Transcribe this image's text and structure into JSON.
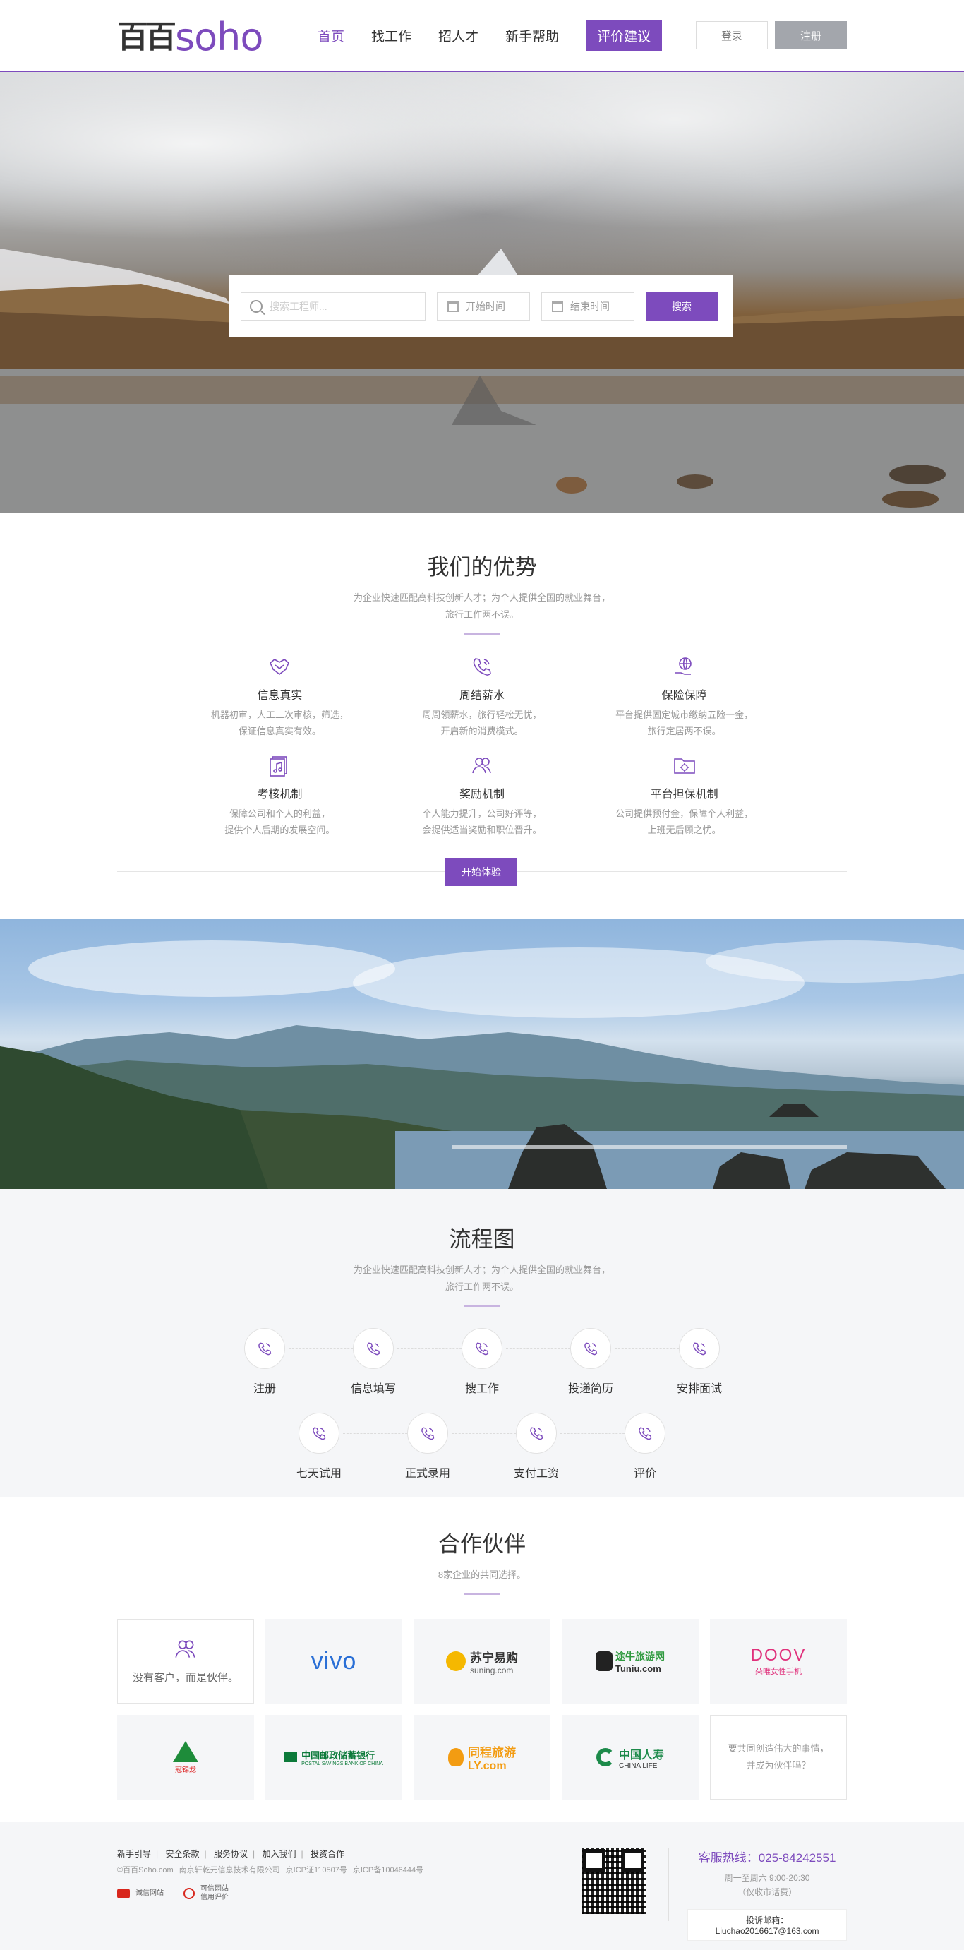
{
  "header": {
    "logo_cn": "百百",
    "logo_en": "soho",
    "nav": [
      "首页",
      "找工作",
      "招人才",
      "新手帮助"
    ],
    "suggest": "评价建议",
    "login": "登录",
    "register": "注册"
  },
  "search": {
    "placeholder": "搜索工程师...",
    "start": "开始时间",
    "end": "结束时间",
    "button": "搜索"
  },
  "advantages": {
    "title": "我们的优势",
    "sub1": "为企业快速匹配高科技创新人才；为个人提供全国的就业舞台，",
    "sub2": "旅行工作两不误。",
    "items": [
      {
        "icon": "handshake-icon",
        "title": "信息真实",
        "l1": "机器初审，人工二次审核，筛选，",
        "l2": "保证信息真实有效。"
      },
      {
        "icon": "phone-icon",
        "title": "周结薪水",
        "l1": "周周领薪水，旅行轻松无忧，",
        "l2": "开启新的消费模式。"
      },
      {
        "icon": "globe-hand-icon",
        "title": "保险保障",
        "l1": "平台提供固定城市缴纳五险一金，",
        "l2": "旅行定居两不误。"
      },
      {
        "icon": "music-file-icon",
        "title": "考核机制",
        "l1": "保障公司和个人的利益，",
        "l2": "提供个人后期的发展空间。"
      },
      {
        "icon": "users-icon",
        "title": "奖励机制",
        "l1": "个人能力提升，公司好评等，",
        "l2": "会提供适当奖励和职位晋升。"
      },
      {
        "icon": "folder-gear-icon",
        "title": "平台担保机制",
        "l1": "公司提供预付金，保障个人利益，",
        "l2": "上班无后顾之忧。"
      }
    ],
    "cta": "开始体验"
  },
  "process": {
    "title": "流程图",
    "sub1": "为企业快速匹配高科技创新人才；为个人提供全国的就业舞台，",
    "sub2": "旅行工作两不误。",
    "row1": [
      "注册",
      "信息填写",
      "搜工作",
      "投递简历",
      "安排面试"
    ],
    "row2": [
      "七天试用",
      "正式录用",
      "支付工资",
      "评价"
    ]
  },
  "partners": {
    "title": "合作伙伴",
    "sub": "8家企业的共同选择。",
    "slogan": "没有客户，而是伙伴。",
    "logos": {
      "vivo": "vivo",
      "suning_cn": "苏宁易购",
      "suning_en": "suning.com",
      "tuniu_cn": "途牛旅游网",
      "tuniu_en": "Tuniu.com",
      "doov_en": "DOOV",
      "doov_cn": "朵唯女性手机",
      "gjl": "冠锦龙",
      "postal_cn": "中国邮政储蓄银行",
      "postal_en": "POSTAL SAVINGS BANK OF CHINA",
      "ly_cn": "同程旅游",
      "ly_en": "LY.com",
      "life_cn": "中国人寿",
      "life_en": "CHINA LIFE"
    },
    "join1": "要共同创造伟大的事情，",
    "join2": "并成为伙伴吗？"
  },
  "footer": {
    "links": [
      "新手引导",
      "安全条款",
      "服务协议",
      "加入我们",
      "投资合作"
    ],
    "copy": "©百百Soho.com",
    "company": "南京轩乾元信息技术有限公司",
    "icp1": "京ICP证110507号",
    "icp2": "京ICP备10046444号",
    "badge1": "诚信网站",
    "badge2a": "可信网站",
    "badge2b": "信用评价",
    "hotline": "客服热线：025-84242551",
    "time1": "周一至周六 9:00-20:30",
    "time2": "（仅收市话费）",
    "email": "投诉邮箱：Liuchao2016617@163.com"
  }
}
